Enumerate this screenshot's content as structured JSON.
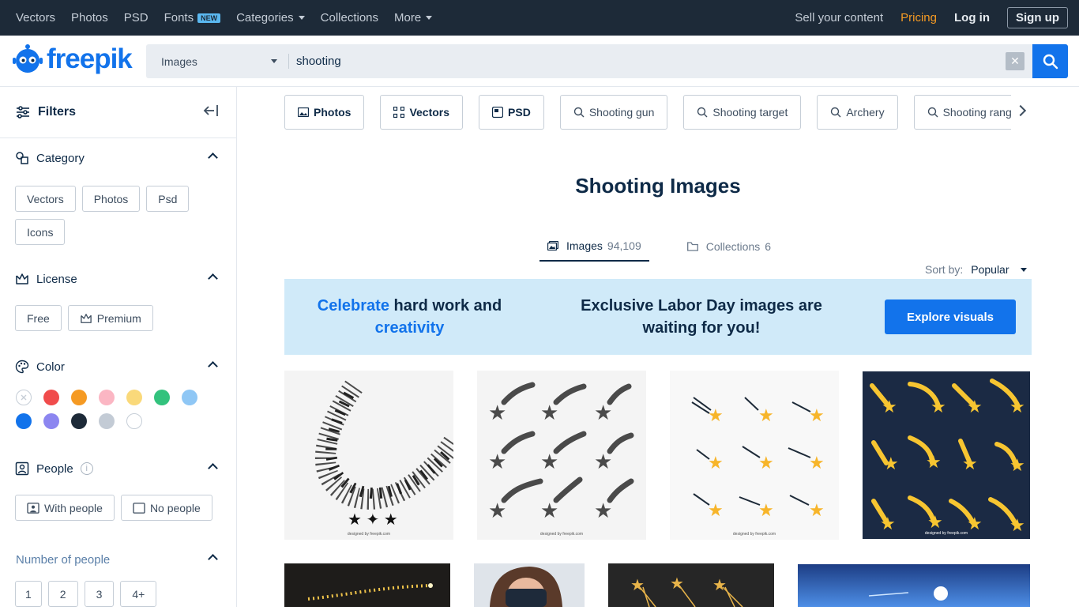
{
  "topnav": {
    "items": [
      "Vectors",
      "Photos",
      "PSD",
      "Fonts",
      "Categories",
      "Collections",
      "More"
    ],
    "fonts_badge": "NEW",
    "sell": "Sell your content",
    "pricing": "Pricing",
    "login": "Log in",
    "signup": "Sign up"
  },
  "brand": {
    "logo_text": "freepik"
  },
  "search": {
    "type": "Images",
    "query": "shooting",
    "clear_icon": "close-icon",
    "button_icon": "search-icon"
  },
  "sidebar": {
    "title": "Filters",
    "category": {
      "label": "Category",
      "chips": [
        "Vectors",
        "Photos",
        "Psd",
        "Icons"
      ]
    },
    "license": {
      "label": "License",
      "chips": [
        "Free",
        "Premium"
      ]
    },
    "color": {
      "label": "Color",
      "swatches": [
        "none",
        "#f04c4c",
        "#f59a23",
        "#fbb6c3",
        "#fad97a",
        "#33c27d",
        "#8fc7f5",
        "#1273eb",
        "#8c86f0",
        "#1d2a38",
        "#c3cbd5",
        "#ffffff"
      ]
    },
    "people": {
      "label": "People",
      "info": "i",
      "chips": [
        "With people",
        "No people"
      ]
    },
    "number_of_people": {
      "label": "Number of people",
      "chips": [
        "1",
        "2",
        "3",
        "4+"
      ]
    }
  },
  "tags": [
    "Photos",
    "Vectors",
    "PSD",
    "Shooting gun",
    "Shooting target",
    "Archery",
    "Shooting range"
  ],
  "page_title": "Shooting Images",
  "tabs": [
    {
      "label": "Images",
      "count": "94,109"
    },
    {
      "label": "Collections",
      "count": "6"
    }
  ],
  "sort": {
    "label": "Sort by:",
    "value": "Popular"
  },
  "banner": {
    "left_accent1": "Celebrate",
    "left_text": " hard work and",
    "left_accent2": "creativity",
    "middle": "Exclusive Labor Day images are waiting for you!",
    "button": "Explore visuals"
  },
  "credits": [
    "designed by freepik.com",
    "designed by freepik.com",
    "designed by freepik.com",
    "designed by freepik.com"
  ],
  "colors": {
    "accent": "#1273eb",
    "topbar": "#1d2a38",
    "pricing": "#f59a23",
    "banner": "#d0eaf9"
  }
}
